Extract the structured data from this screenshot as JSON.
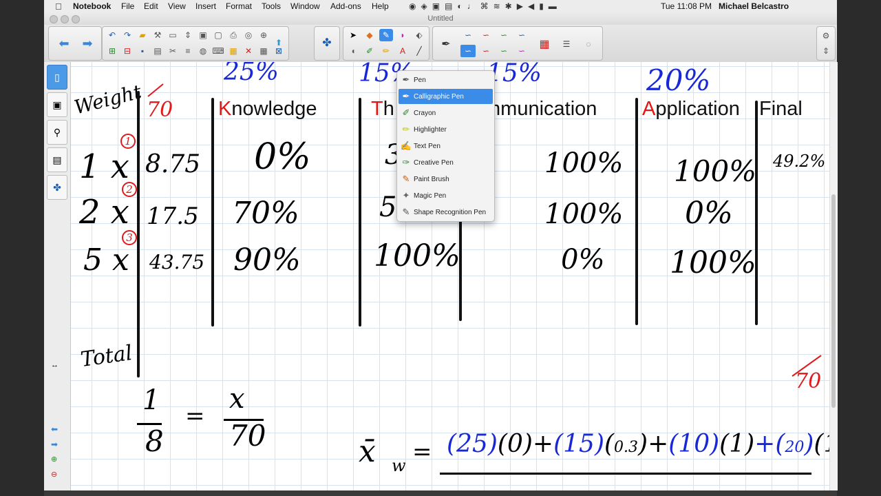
{
  "menubar": {
    "apple": "",
    "app_name": "Notebook",
    "menus": [
      "File",
      "Edit",
      "View",
      "Insert",
      "Format",
      "Tools",
      "Window",
      "Add-ons",
      "Help"
    ],
    "clock": "Tue 11:08 PM",
    "user": "Michael Belcastro"
  },
  "window": {
    "title": "Untitled"
  },
  "pen_menu": {
    "items": [
      "Pen",
      "Calligraphic Pen",
      "Crayon",
      "Highlighter",
      "Text Pen",
      "Creative Pen",
      "Paint Brush",
      "Magic Pen",
      "Shape Recognition Pen"
    ],
    "selected": "Calligraphic Pen"
  },
  "board": {
    "weight_label": "Weight",
    "total_label": "Total",
    "out_of": "70",
    "out_of_bottom": "70",
    "headers": [
      {
        "cap": "K",
        "rest": "nowledge"
      },
      {
        "cap": "T",
        "rest": "h"
      },
      {
        "cap": "",
        "rest": "mmunication"
      },
      {
        "cap": "A",
        "rest": "pplication"
      },
      {
        "cap": "",
        "rest": "Final"
      }
    ],
    "weights_top": [
      "25%",
      "15%",
      "15%",
      "20%"
    ],
    "rows": [
      {
        "marker": "1",
        "weight": "1 x",
        "score": "8.75",
        "k": "0%",
        "t": "3",
        "c": "100%",
        "a": "100%",
        "final": "49.2%"
      },
      {
        "marker": "2",
        "weight": "2 x",
        "score": "17.5",
        "k": "70%",
        "t": "5",
        "c": "100%",
        "a": "0%",
        "final": ""
      },
      {
        "marker": "3",
        "weight": "5 x",
        "score": "43.75",
        "k": "90%",
        "t": "100%",
        "c": "0%",
        "a": "100%",
        "final": ""
      }
    ],
    "fraction": {
      "num": "1",
      "den": "8",
      "eq": "=",
      "num2": "x",
      "den2": "70"
    },
    "formula": {
      "lhs": "x̄",
      "sub": "w",
      "eq": "=",
      "t1w": "25",
      "t1v": "0",
      "t2w": "15",
      "t2v": "0.3",
      "t3w": "10",
      "t3v": "1",
      "t4w": "20",
      "t4v": "1"
    },
    "colors": {
      "blue": "#1828d6",
      "red": "#e01a1a",
      "header_cap": "#e31616"
    }
  }
}
